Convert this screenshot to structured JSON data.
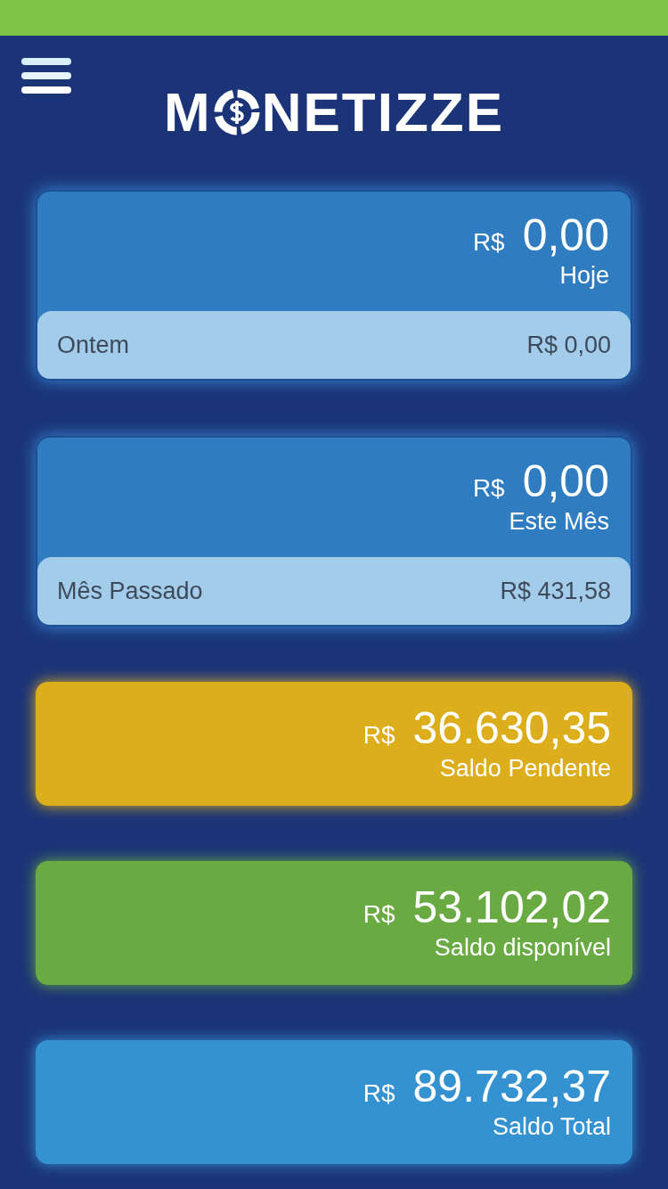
{
  "logo": {
    "before": "M",
    "after": "NETIZZE"
  },
  "cards": [
    {
      "kind": "split",
      "currency": "R$",
      "amount": "0,00",
      "label": "Hoje",
      "footer_label": "Ontem",
      "footer_value": "R$ 0,00"
    },
    {
      "kind": "split",
      "currency": "R$",
      "amount": "0,00",
      "label": "Este Mês",
      "footer_label": "Mês Passado",
      "footer_value": "R$ 431,58"
    },
    {
      "kind": "solid",
      "color": "#ddae1c",
      "currency": "R$",
      "amount": "36.630,35",
      "label": "Saldo Pendente"
    },
    {
      "kind": "solid",
      "color": "#6aaa43",
      "currency": "R$",
      "amount": "53.102,02",
      "label": "Saldo disponível"
    },
    {
      "kind": "solid",
      "color": "#3592d1",
      "currency": "R$",
      "amount": "89.732,37",
      "label": "Saldo Total"
    }
  ]
}
